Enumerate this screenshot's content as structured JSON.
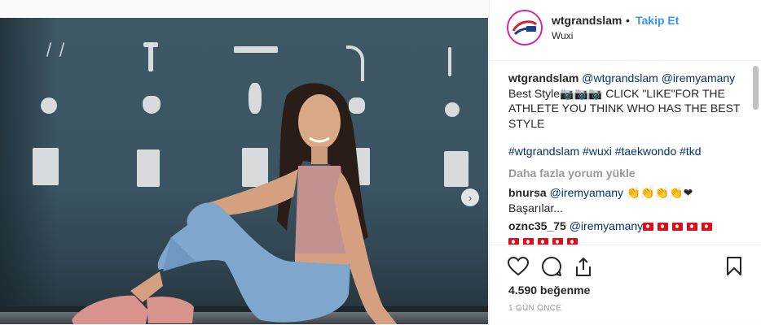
{
  "post": {
    "username": "wtgrandslam",
    "separator": "•",
    "follow_label": "Takip Et",
    "location": "Wuxi",
    "caption": {
      "username": "wtgrandslam",
      "mention1": "@wtgrandslam",
      "mention2": "@iremyamany",
      "text": "Best Style📷📷📷 CLICK \"LIKE\"FOR THE ATHLETE YOU THINK WHO HAS THE BEST STYLE",
      "hashtags": "#wtgrandslam #wuxi #taekwondo #tkd"
    },
    "load_more": "Daha fazla yorum yükle",
    "comments": [
      {
        "username": "bnursa",
        "mention": "@iremyamany",
        "text_suffix": "👏👏👏👏❤",
        "text_line2": "Başarılar..."
      },
      {
        "username": "oznc35_75",
        "mention": "@iremyamany"
      }
    ],
    "likes_text": "4.590 beğenme",
    "time_text": "1 GÜN ÖNCE",
    "next_arrow": "›"
  },
  "colors": {
    "accent": "#3897f0",
    "link": "#003569",
    "muted": "#999999"
  },
  "icons": [
    "heart-icon",
    "comment-icon",
    "share-icon",
    "bookmark-icon",
    "chevron-right-icon"
  ]
}
